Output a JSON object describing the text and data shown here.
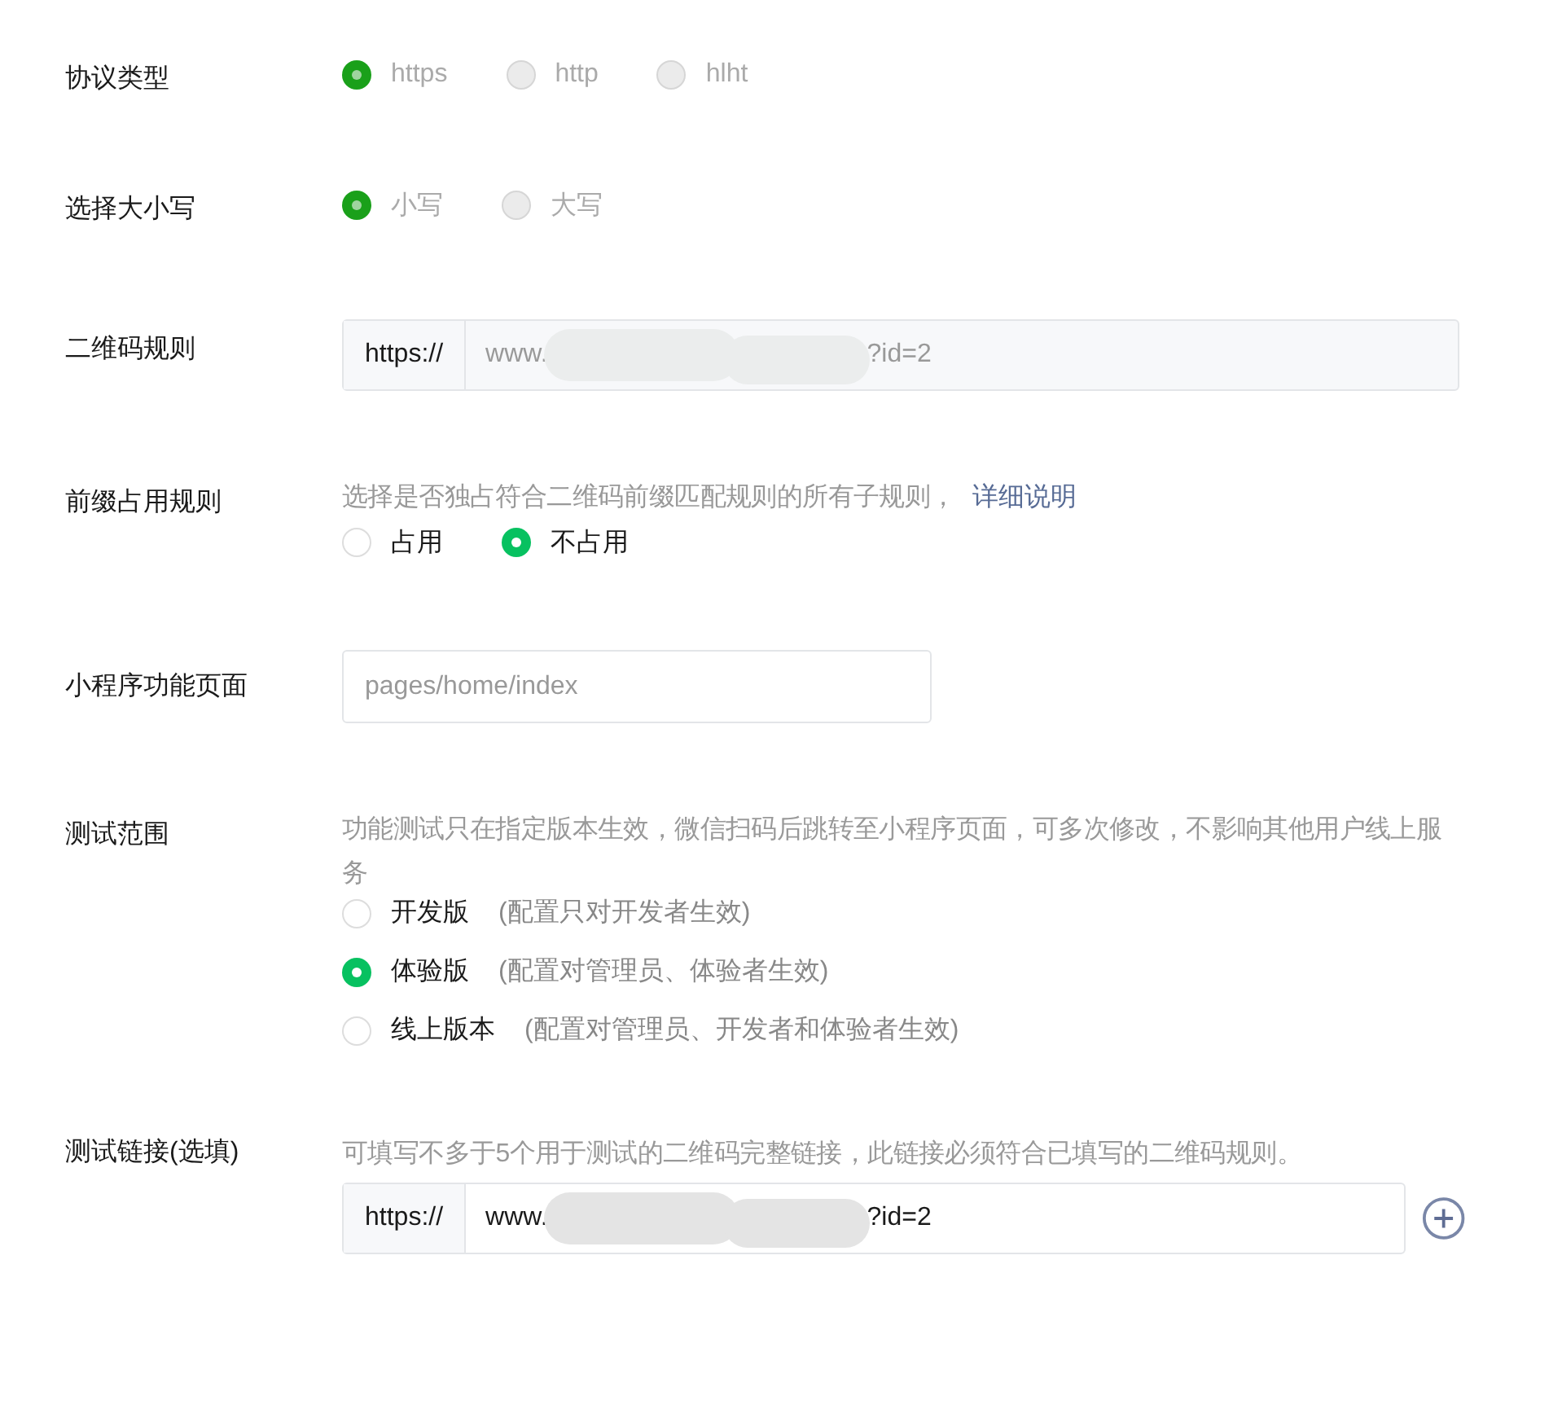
{
  "fields": [
    {
      "kind": "radio",
      "label": "协议类型",
      "disabled": true,
      "options": [
        {
          "label": "https",
          "selected": true
        },
        {
          "label": "http",
          "selected": false
        },
        {
          "label": "hlht",
          "selected": false
        }
      ]
    },
    {
      "kind": "radio",
      "label": "选择大小写",
      "disabled": true,
      "options": [
        {
          "label": "小写",
          "selected": true
        },
        {
          "label": "大写",
          "selected": false
        }
      ]
    },
    {
      "kind": "url",
      "label": "二维码规则",
      "disabled": true,
      "prefix": "https://",
      "value_start": "www.",
      "value_end": "?id=2"
    },
    {
      "kind": "radio",
      "label": "前缀占用规则",
      "disabled": false,
      "hint": "选择是否独占符合二维码前缀匹配规则的所有子规则，",
      "link": "详细说明",
      "options": [
        {
          "label": "占用",
          "selected": false
        },
        {
          "label": "不占用",
          "selected": true
        }
      ]
    },
    {
      "kind": "text",
      "label": "小程序功能页面",
      "placeholder": "pages/home/index"
    },
    {
      "kind": "radio",
      "label": "测试范围",
      "disabled": false,
      "hint": "功能测试只在指定版本生效，微信扫码后跳转至小程序页面，可多次修改，不影响其他用户线上服务",
      "options": [
        {
          "label": "开发版",
          "note": "(配置只对开发者生效)",
          "selected": false
        },
        {
          "label": "体验版",
          "note": "(配置对管理员、体验者生效)",
          "selected": true
        },
        {
          "label": "线上版本",
          "note": "(配置对管理员、开发者和体验者生效)",
          "selected": false
        }
      ]
    },
    {
      "kind": "url",
      "label": "测试链接(选填)",
      "disabled": false,
      "hint": "可填写不多于5个用于测试的二维码完整链接，此链接必须符合已填写的二维码规则。",
      "prefix": "https://",
      "value_start": "www.",
      "value_end": "?id=2",
      "addable": true
    }
  ]
}
